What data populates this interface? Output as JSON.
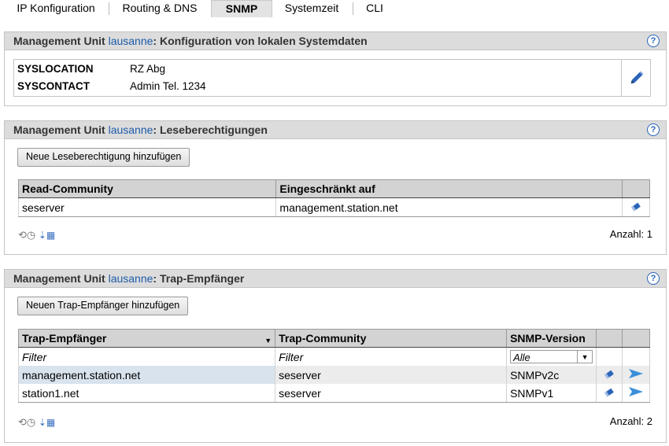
{
  "tabs": [
    {
      "label": "IP Konfiguration"
    },
    {
      "label": "Routing & DNS"
    },
    {
      "label": "SNMP",
      "active": true
    },
    {
      "label": "Systemzeit"
    },
    {
      "label": "CLI"
    }
  ],
  "prefix": "Management Unit",
  "unit": "lausanne",
  "panels": {
    "system": {
      "title": "Konfiguration von lokalen Systemdaten",
      "rows": [
        {
          "key": "SYSLOCATION",
          "value": "RZ Abg"
        },
        {
          "key": "SYSCONTACT",
          "value": "Admin Tel. 1234"
        }
      ]
    },
    "read": {
      "title": "Leseberechtigungen",
      "add_button": "Neue Leseberechtigung hinzufügen",
      "columns": [
        "Read-Community",
        "Eingeschränkt auf"
      ],
      "rows": [
        {
          "community": "seserver",
          "restricted": "management.station.net"
        }
      ],
      "count": "Anzahl: 1"
    },
    "trap": {
      "title": "Trap-Empfänger",
      "add_button": "Neuen Trap-Empfänger hinzufügen",
      "columns": [
        "Trap-Empfänger",
        "Trap-Community",
        "SNMP-Version"
      ],
      "filter": {
        "c1": "Filter",
        "c2": "Filter",
        "version": "Alle"
      },
      "rows": [
        {
          "receiver": "management.station.net",
          "community": "seserver",
          "version": "SNMPv2c"
        },
        {
          "receiver": "station1.net",
          "community": "seserver",
          "version": "SNMPv1"
        }
      ],
      "count": "Anzahl: 2"
    }
  },
  "colors": {
    "accent": "#1e5ba8",
    "header_bg": "#dcdcdc"
  }
}
